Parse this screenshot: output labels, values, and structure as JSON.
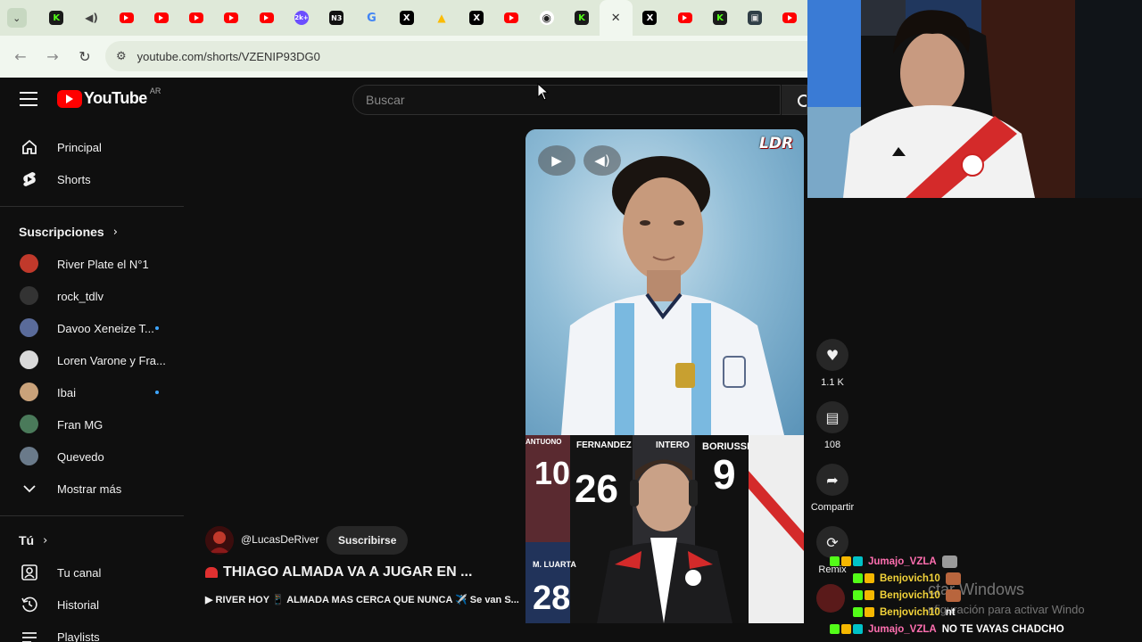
{
  "browser": {
    "tabs": [
      {
        "icon": "youtube-icon",
        "label": ""
      },
      {
        "icon": "youtube-icon",
        "label": ""
      },
      {
        "icon": "youtube-icon",
        "label": ""
      },
      {
        "icon": "youtube-icon",
        "label": ""
      },
      {
        "icon": "youtube-icon",
        "label": ""
      },
      {
        "icon": "ai-icon",
        "label": "2k+"
      },
      {
        "icon": "news-icon",
        "label": "N3"
      },
      {
        "icon": "google-icon",
        "label": "G"
      },
      {
        "icon": "x-icon",
        "label": "X"
      },
      {
        "icon": "drive-icon",
        "label": "▲"
      },
      {
        "icon": "x-icon",
        "label": "X"
      },
      {
        "icon": "youtube-icon",
        "label": ""
      },
      {
        "icon": "github-icon",
        "label": "◉"
      },
      {
        "icon": "kick-icon",
        "label": "K"
      }
    ],
    "active_tab_close": "✕",
    "tabs_after": [
      {
        "icon": "x-icon",
        "label": "X"
      },
      {
        "icon": "youtube-icon",
        "label": ""
      },
      {
        "icon": "kick-icon",
        "label": "K"
      },
      {
        "icon": "app-icon",
        "label": "▣"
      },
      {
        "icon": "youtube-icon",
        "label": ""
      }
    ],
    "first_tabs": [
      {
        "icon": "kick-icon",
        "label": "K"
      },
      {
        "icon": "speaker-icon",
        "label": "◀)"
      }
    ],
    "url": "youtube.com/shorts/VZENIP93DG0"
  },
  "youtube": {
    "logo_text": "YouTube",
    "country": "AR",
    "search_placeholder": "Buscar",
    "nav": [
      {
        "label": "Principal",
        "icon": "home-icon"
      },
      {
        "label": "Shorts",
        "icon": "shorts-icon"
      }
    ],
    "subscriptions_title": "Suscripciones",
    "subscriptions": [
      {
        "label": "River Plate el N°1",
        "color": "#c0392b",
        "live": false
      },
      {
        "label": "rock_tdlv",
        "color": "#333333",
        "live": false
      },
      {
        "label": "Davoo Xeneize T...",
        "color": "#5a6b9a",
        "live": true
      },
      {
        "label": "Loren Varone y Fra...",
        "color": "#d9d9d9",
        "live": false
      },
      {
        "label": "Ibai",
        "color": "#c9a27a",
        "live": true
      },
      {
        "label": "Fran MG",
        "color": "#4a7a5a",
        "live": false
      },
      {
        "label": "Quevedo",
        "color": "#6a7a8a",
        "live": false
      }
    ],
    "show_more": "Mostrar más",
    "you_title": "Tú",
    "you_items": [
      {
        "label": "Tu canal",
        "icon": "channel-icon"
      },
      {
        "label": "Historial",
        "icon": "history-icon"
      },
      {
        "label": "Playlists",
        "icon": "playlists-icon"
      }
    ]
  },
  "short": {
    "watermark": "LDR",
    "jersey_numbers": [
      "26",
      "9",
      "28",
      "10"
    ],
    "jersey_names": [
      "FERNANDEZ",
      "INTERO",
      "BORIUSSI",
      "M. LUARTA",
      "ANTUONO"
    ],
    "actions": {
      "likes": "1.1 K",
      "comments": "108",
      "share": "Compartir",
      "remix": "Remix"
    },
    "channel": "@LucasDeRiver",
    "subscribe": "Suscribirse",
    "title": "THIAGO ALMADA VA A JUGAR EN ...",
    "description": "▶ RIVER HOY 📱 ALMADA MAS CERCA QUE NUNCA ✈️ Se van S..."
  },
  "chat": [
    {
      "user": "Jumajo_VZLA",
      "color": "#ff6fb0",
      "message": "",
      "emote": "#9a9a9a"
    },
    {
      "user": "Benjovich10",
      "color": "#f2d33a",
      "message": "",
      "emote": "#b8653d"
    },
    {
      "user": "Benjovich10",
      "color": "#f2d33a",
      "message": "",
      "emote": "#b8653d"
    },
    {
      "user": "Benjovich10",
      "color": "#f2d33a",
      "message": "nt",
      "emote": ""
    },
    {
      "user": "Jumajo_VZLA",
      "color": "#ff6fb0",
      "message": "NO TE VAYAS CHADCHO",
      "emote": ""
    }
  ],
  "windows_watermark": {
    "line1": "ctar Windows",
    "line2": "nfiguración para activar Windo"
  },
  "colors": {
    "youtube_red": "#ff0000",
    "kick_green": "#53fc18",
    "bg": "#0f0f0f"
  }
}
